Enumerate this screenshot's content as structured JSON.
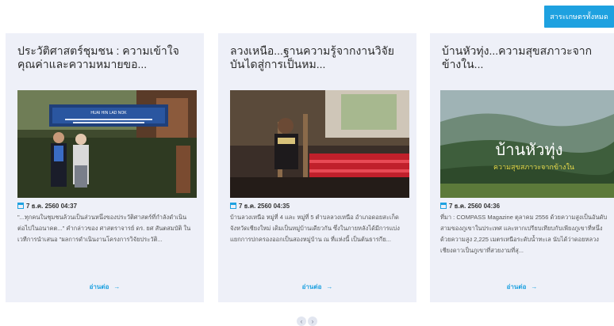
{
  "header": {
    "button_label": "สาระเกษตรทั้งหมด"
  },
  "cards": [
    {
      "title": "ประวัติศาสตร์ชุมชน : ความเข้าใจคุณค่าและความหมายขอ...",
      "date": "7 ธ.ค. 2560 04:37",
      "excerpt": "\"...ทุกคนในชุมชนล้วนเป็นส่วนหนึ่งของประวัติศาสตร์ที่กำลังดำเนินต่อไปในอนาคต...\" คำกล่าวของ ศาสตราจารย์ ดร. ยศ สันตสมบัติ ในเวทีการนำเสนอ \"ผลการดำเนินงานโครงการวิจัยประวัติ...",
      "read_more": "อ่านต่อ",
      "sign_text": "HUAI HIN LAD NOK"
    },
    {
      "title": "ลวงเหนือ...ฐานความรู้จากงานวิจัยบันไดสู่การเป็นหม...",
      "date": "7 ธ.ค. 2560 04:35",
      "excerpt": "บ้านลวงเหนือ หมู่ที่ 4 และ หมู่ที่ 5 ตำบลลวงเหนือ อำเภอดอยสะเก็ด จังหวัดเชียงใหม่ เดิมเป็นหมู่บ้านเดียวกัน ซึ่งในภายหลังได้มีการแบ่งแยกการปกครองออกเป็นสองหมู่บ้าน ณ ที่แห่งนี้ เป็นต้นธารกีย...",
      "read_more": "อ่านต่อ"
    },
    {
      "title": "บ้านหัวทุ่ง...ความสุขสภาวะจากข้างใน...",
      "date": "7 ธ.ค. 2560 04:36",
      "excerpt": "ที่มา : COMPASS Magazine ตุลาคม 2556 ด้วยความสูงเป็นอันดับสามของภูเขาในประเทศ และหากเปรียบเทียบกับเพียงภูเขาที่หนึ่ง ด้วยความสูง 2,225 เมตรเหนือระดับน้ำทะเล นับได้ว่าดอยหลวงเชียงดาวเป็นภูเขาที่สวยงามที่สุ...",
      "read_more": "อ่านต่อ",
      "overlay_title": "บ้านหัวทุ่ง",
      "overlay_subtitle": "ความสุขสภาวะจากข้างใน"
    }
  ],
  "pager": {
    "prev": "‹",
    "next": "›"
  },
  "colors": {
    "accent": "#1ea1e0",
    "card_bg": "#eef0f8"
  }
}
